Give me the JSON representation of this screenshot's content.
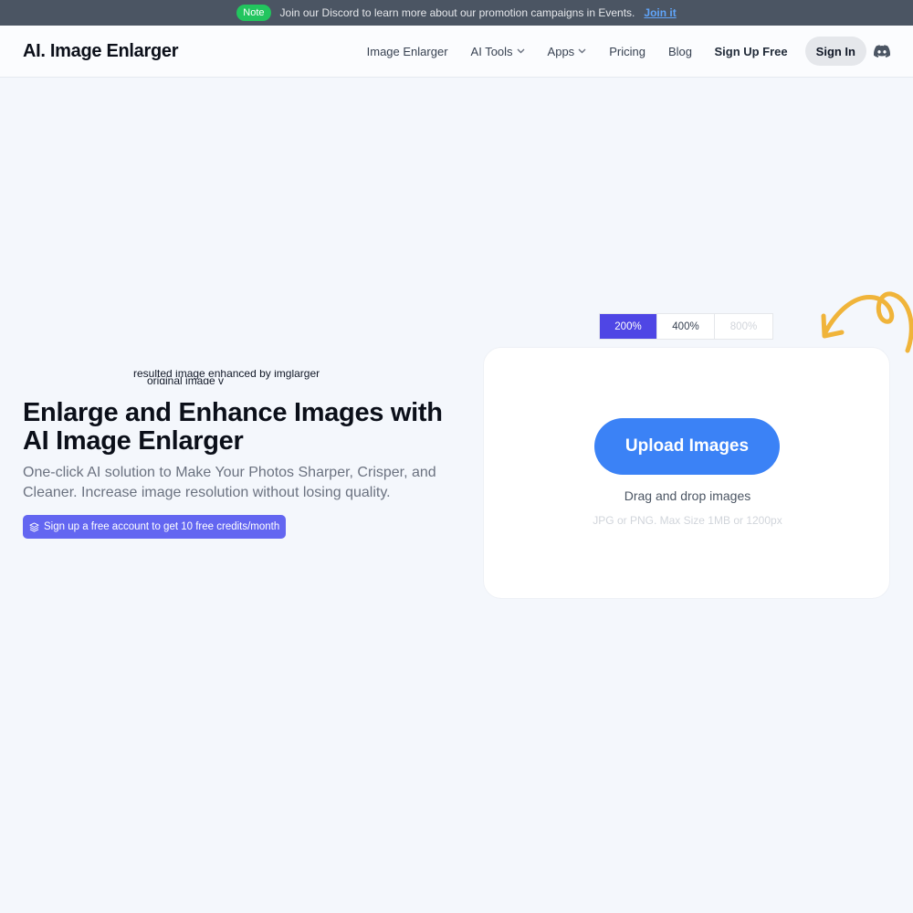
{
  "announcement": {
    "badge": "Note",
    "text": "Join our Discord to learn more about our promotion campaigns in Events.",
    "link": "Join it"
  },
  "nav": {
    "logo": "AI. Image Enlarger",
    "links": [
      {
        "label": "Image Enlarger"
      },
      {
        "label": "AI Tools",
        "icon": "chevron-down-icon"
      },
      {
        "label": "Apps",
        "icon": "chevron-down-icon"
      },
      {
        "label": "Pricing"
      },
      {
        "label": "Blog"
      }
    ],
    "signup": "Sign Up Free",
    "signin": "Sign In",
    "discord_icon": "discord-icon"
  },
  "hero": {
    "image_alt_1": "resulted image enhanced by imglarger",
    "image_alt_2": "original image v",
    "title": "Enlarge and Enhance Images with AI Image Enlarger",
    "subtitle": "One-click AI solution to Make Your Photos Sharper, Crisper, and Cleaner. Increase image resolution without losing quality.",
    "credit_pill": "Sign up a free account to get 10 free credits/month",
    "credit_icon": "layers-icon"
  },
  "zoom": {
    "options": [
      "200%",
      "400%",
      "800%"
    ],
    "selected": "200%"
  },
  "upload": {
    "button": "Upload Images",
    "drag_text": "Drag and drop images",
    "limits": "JPG or PNG. Max Size 1MB or 1200px"
  },
  "colors": {
    "accent_blue": "#3b82f6",
    "accent_indigo": "#4f46e5",
    "pill_purple": "#6366f1",
    "note_green": "#22c55e",
    "doodle_yellow": "#f0b43a"
  }
}
